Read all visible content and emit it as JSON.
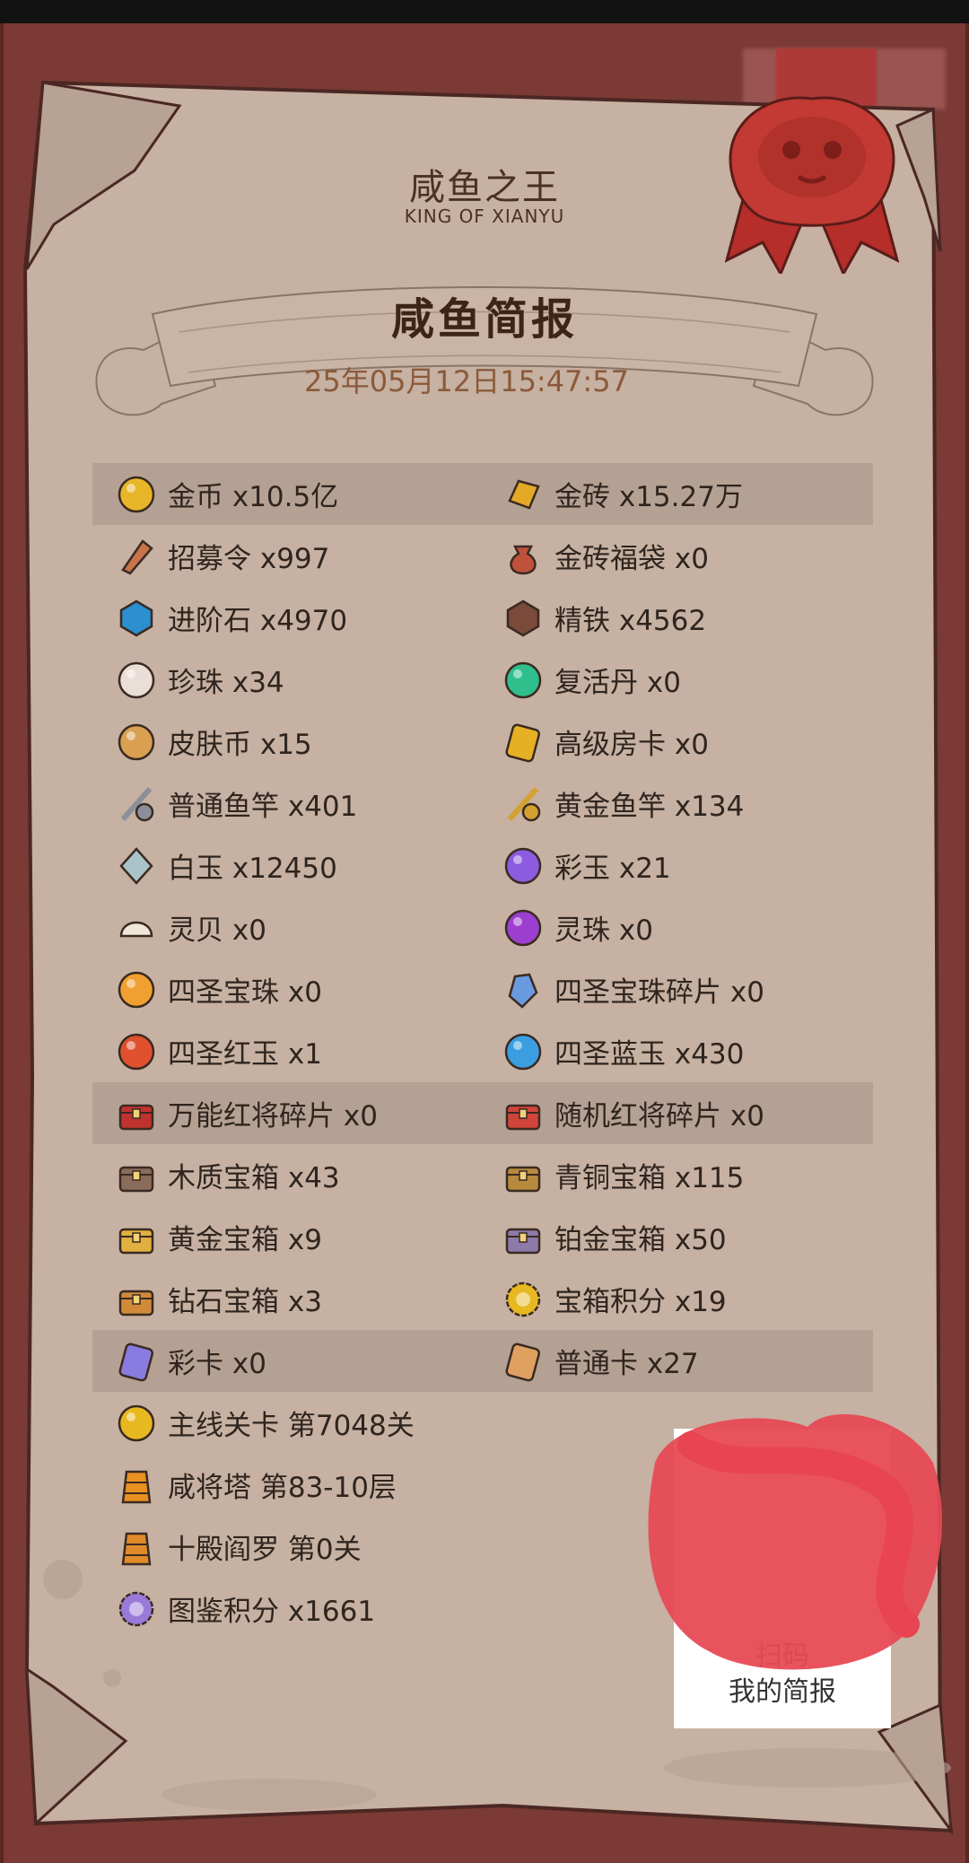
{
  "header": {
    "title": "咸鱼之王",
    "subtitle": "KING OF XIANYU"
  },
  "report": {
    "title": "咸鱼简报",
    "datetime": "25年05月12日15:47:57"
  },
  "rows": [
    {
      "highlight": true,
      "left": {
        "icon": "gold-coin-icon",
        "text": "金币 x10.5亿"
      },
      "right": {
        "icon": "gold-brick-icon",
        "text": "金砖 x15.27万"
      }
    },
    {
      "highlight": false,
      "left": {
        "icon": "recruit-token-icon",
        "text": "招募令 x997"
      },
      "right": {
        "icon": "gold-bag-icon",
        "text": "金砖福袋 x0"
      }
    },
    {
      "highlight": false,
      "left": {
        "icon": "advance-stone-icon",
        "text": "进阶石 x4970"
      },
      "right": {
        "icon": "refined-iron-icon",
        "text": "精铁 x4562"
      }
    },
    {
      "highlight": false,
      "left": {
        "icon": "pearl-icon",
        "text": "珍珠 x34"
      },
      "right": {
        "icon": "revive-pill-icon",
        "text": "复活丹 x0"
      }
    },
    {
      "highlight": false,
      "left": {
        "icon": "skin-coin-icon",
        "text": "皮肤币 x15"
      },
      "right": {
        "icon": "room-card-icon",
        "text": "高级房卡 x0"
      }
    },
    {
      "highlight": false,
      "left": {
        "icon": "fishing-rod-icon",
        "text": "普通鱼竿 x401"
      },
      "right": {
        "icon": "gold-fishing-rod-icon",
        "text": "黄金鱼竿 x134"
      }
    },
    {
      "highlight": false,
      "left": {
        "icon": "white-jade-icon",
        "text": "白玉 x12450"
      },
      "right": {
        "icon": "rainbow-jade-icon",
        "text": "彩玉 x21"
      }
    },
    {
      "highlight": false,
      "left": {
        "icon": "spirit-shell-icon",
        "text": "灵贝 x0"
      },
      "right": {
        "icon": "spirit-orb-icon",
        "text": "灵珠 x0"
      }
    },
    {
      "highlight": false,
      "left": {
        "icon": "holy-orb-icon",
        "text": "四圣宝珠 x0"
      },
      "right": {
        "icon": "holy-orb-shard-icon",
        "text": "四圣宝珠碎片 x0"
      }
    },
    {
      "highlight": false,
      "left": {
        "icon": "red-jade-icon",
        "text": "四圣红玉 x1"
      },
      "right": {
        "icon": "blue-jade-icon",
        "text": "四圣蓝玉 x430"
      }
    },
    {
      "highlight": true,
      "left": {
        "icon": "universal-shard-icon",
        "text": "万能红将碎片 x0"
      },
      "right": {
        "icon": "random-shard-icon",
        "text": "随机红将碎片 x0"
      }
    },
    {
      "highlight": false,
      "left": {
        "icon": "wood-chest-icon",
        "text": "木质宝箱 x43"
      },
      "right": {
        "icon": "bronze-chest-icon",
        "text": "青铜宝箱 x115"
      }
    },
    {
      "highlight": false,
      "left": {
        "icon": "gold-chest-icon",
        "text": "黄金宝箱 x9"
      },
      "right": {
        "icon": "platinum-chest-icon",
        "text": "铂金宝箱 x50"
      }
    },
    {
      "highlight": false,
      "left": {
        "icon": "diamond-chest-icon",
        "text": "钻石宝箱 x3"
      },
      "right": {
        "icon": "chest-points-icon",
        "text": "宝箱积分 x19"
      }
    },
    {
      "highlight": true,
      "left": {
        "icon": "rainbow-card-icon",
        "text": "彩卡 x0"
      },
      "right": {
        "icon": "normal-card-icon",
        "text": "普通卡 x27"
      }
    },
    {
      "highlight": false,
      "left": {
        "icon": "main-stage-icon",
        "text": "主线关卡 第7048关"
      },
      "right": null
    },
    {
      "highlight": false,
      "left": {
        "icon": "tower-icon",
        "text": "咸将塔 第83-10层"
      },
      "right": null
    },
    {
      "highlight": false,
      "left": {
        "icon": "yama-icon",
        "text": "十殿阎罗 第0关"
      },
      "right": null
    },
    {
      "highlight": false,
      "left": {
        "icon": "codex-points-icon",
        "text": "图鉴积分 x1661"
      },
      "right": null
    }
  ],
  "qr": {
    "caption_line1": "扫码",
    "caption_line2": "我的简报"
  },
  "colors": {
    "frame": "#7b3a35",
    "paper": "#c6b1a2",
    "highlight_row": "#b5a193",
    "text": "#2f241e",
    "date": "#8a5a3a",
    "seal": "#c0352f"
  }
}
